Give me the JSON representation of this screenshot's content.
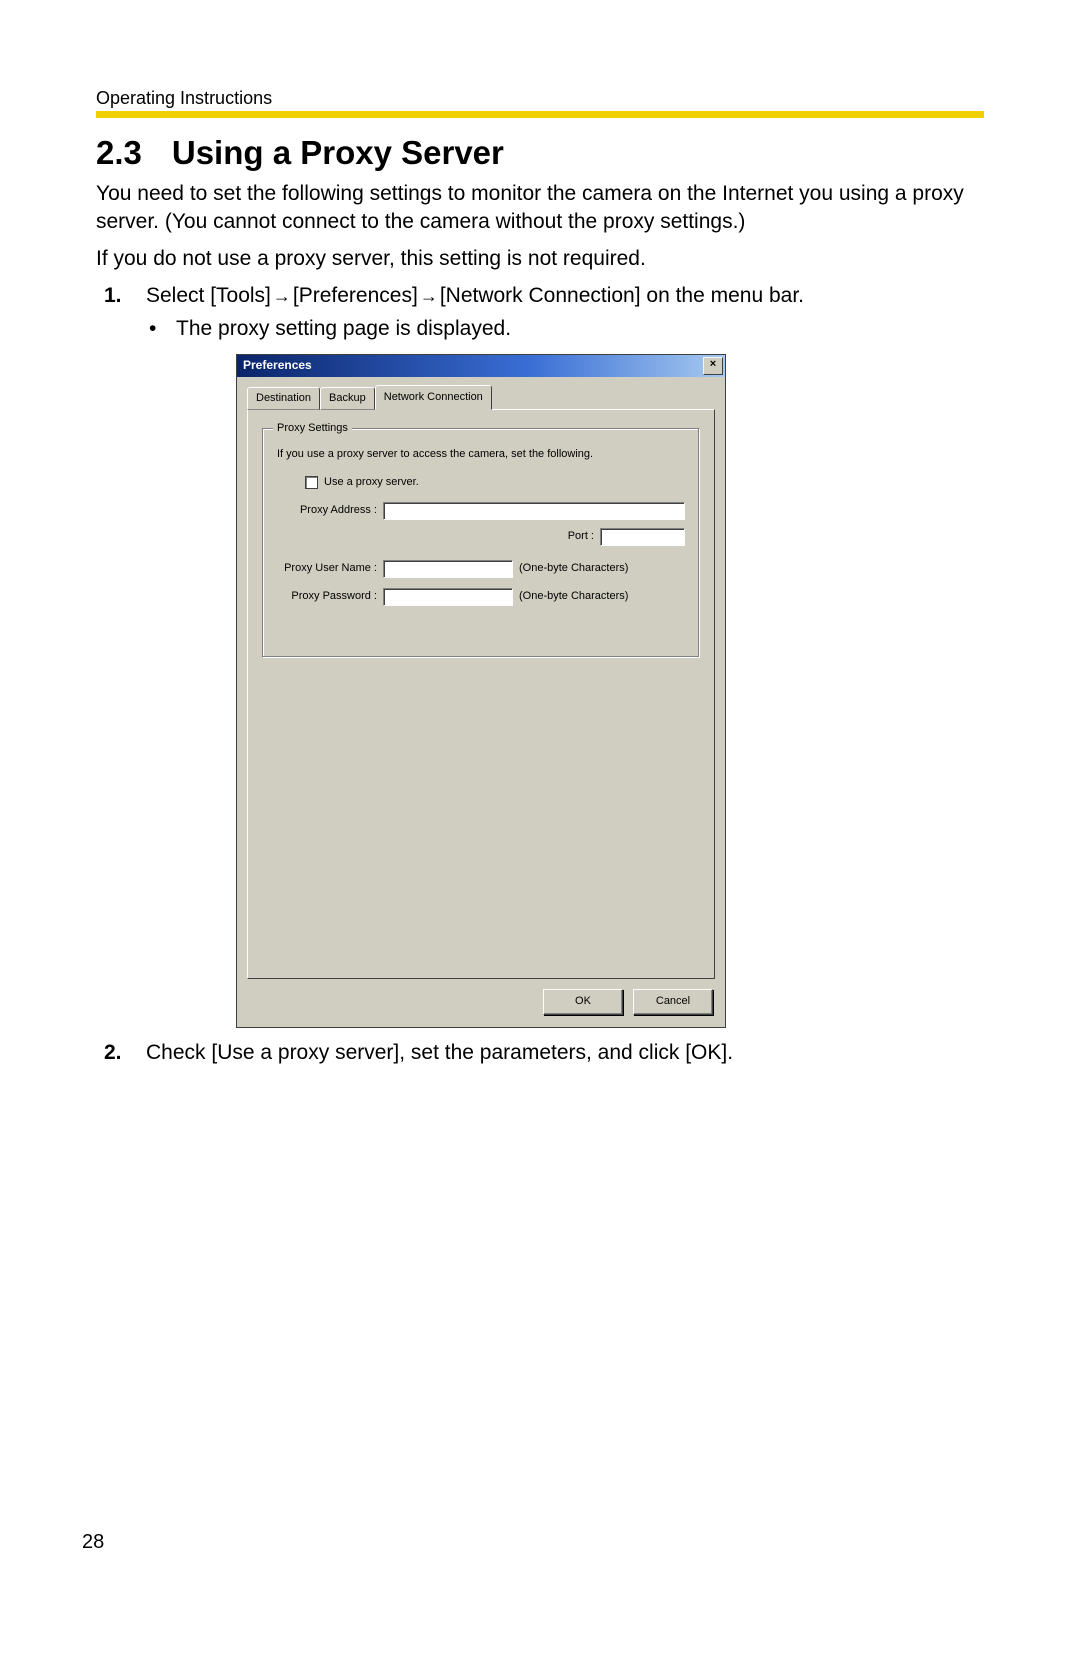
{
  "header": "Operating Instructions",
  "section_number": "2.3",
  "section_title": "Using a Proxy Server",
  "para1": "You need to set the following settings to monitor the camera on the Internet you using a proxy server. (You cannot connect to the camera without the proxy settings.)",
  "para2": "If you do not use a proxy server, this setting is not required.",
  "step1_num": "1.",
  "step1_a": "Select [Tools]",
  "step1_b": "[Preferences]",
  "step1_c": "[Network Connection] on the menu bar.",
  "step1_bullet": "The proxy setting page is displayed.",
  "step2_num": "2.",
  "step2_text": "Check [Use a proxy server], set the parameters, and click [OK].",
  "dialog": {
    "title": "Preferences",
    "close": "×",
    "tabs": {
      "destination": "Destination",
      "backup": "Backup",
      "network": "Network Connection"
    },
    "fieldset_legend": "Proxy Settings",
    "fieldset_desc": "If you use a proxy server to access the camera, set the following.",
    "use_proxy_label": "Use a proxy server.",
    "proxy_address_label": "Proxy Address :",
    "port_label": "Port :",
    "proxy_user_label": "Proxy User Name :",
    "proxy_password_label": "Proxy Password :",
    "onebyte_hint": "(One-byte Characters)",
    "ok": "OK",
    "cancel": "Cancel"
  },
  "page_number": "28"
}
